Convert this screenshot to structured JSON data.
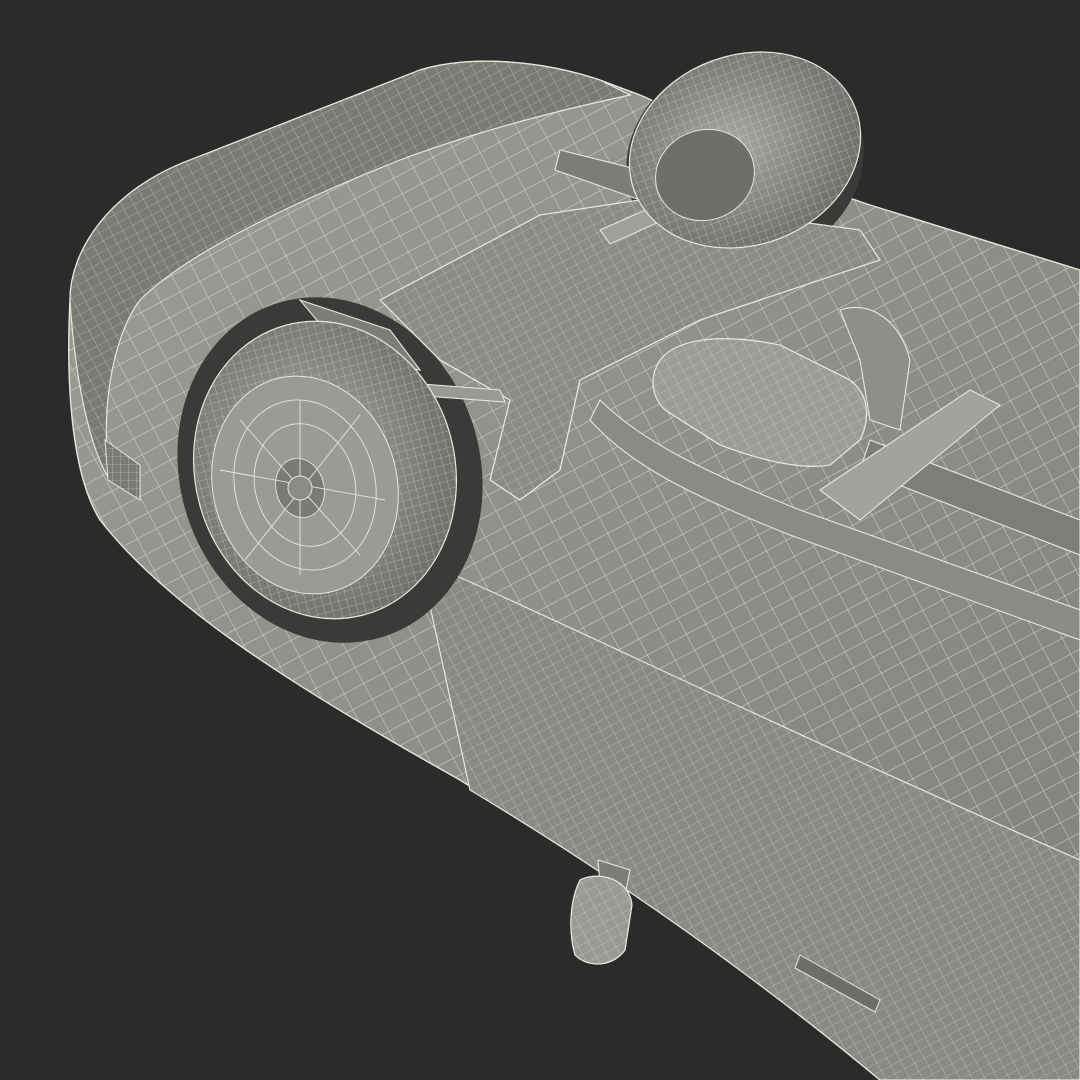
{
  "scene": {
    "subject": "",
    "colors": {
      "background": "#2b2b2b",
      "body_fill": "#8f8e89",
      "body_fill_light": "#a3a29c",
      "body_fill_dark": "#6e6d69",
      "wire": "#e8e6de",
      "shadow": "#3a3a38"
    }
  }
}
